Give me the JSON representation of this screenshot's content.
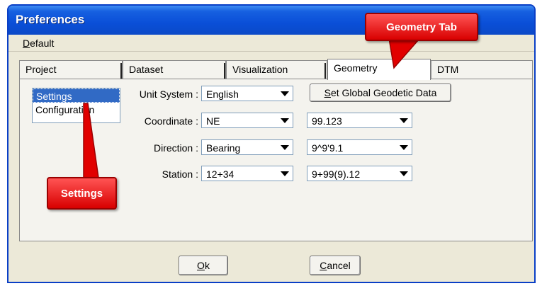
{
  "window": {
    "title": "Preferences"
  },
  "menu": {
    "default_label_ul": "D",
    "default_label_rest": "efault"
  },
  "tabs": [
    {
      "label": "Project"
    },
    {
      "label": "Dataset"
    },
    {
      "label": "Visualization"
    },
    {
      "label": "Geometry"
    },
    {
      "label": "DTM"
    }
  ],
  "sidebar": {
    "items": [
      {
        "label": "Settings"
      },
      {
        "label": "Configuration"
      }
    ]
  },
  "fields": {
    "unit_system": {
      "label": "Unit System :",
      "value": "English"
    },
    "coordinate": {
      "label": "Coordinate :",
      "value": "NE",
      "format": "99.123"
    },
    "direction": {
      "label": "Direction :",
      "value": "Bearing",
      "format": "9^9'9.1"
    },
    "station": {
      "label": "Station :",
      "value": "12+34",
      "format": "9+99(9).12"
    }
  },
  "buttons": {
    "set_global_ul": "S",
    "set_global_rest": "et Global Geodetic Data",
    "ok_ul": "O",
    "ok_rest": "k",
    "cancel_ul": "C",
    "cancel_rest": "ancel"
  },
  "callouts": {
    "geometry_tab": "Geometry Tab",
    "settings": "Settings"
  },
  "colors": {
    "callout": "#e60000",
    "titlebar": "#0a4fd8",
    "selection": "#316ac5"
  }
}
